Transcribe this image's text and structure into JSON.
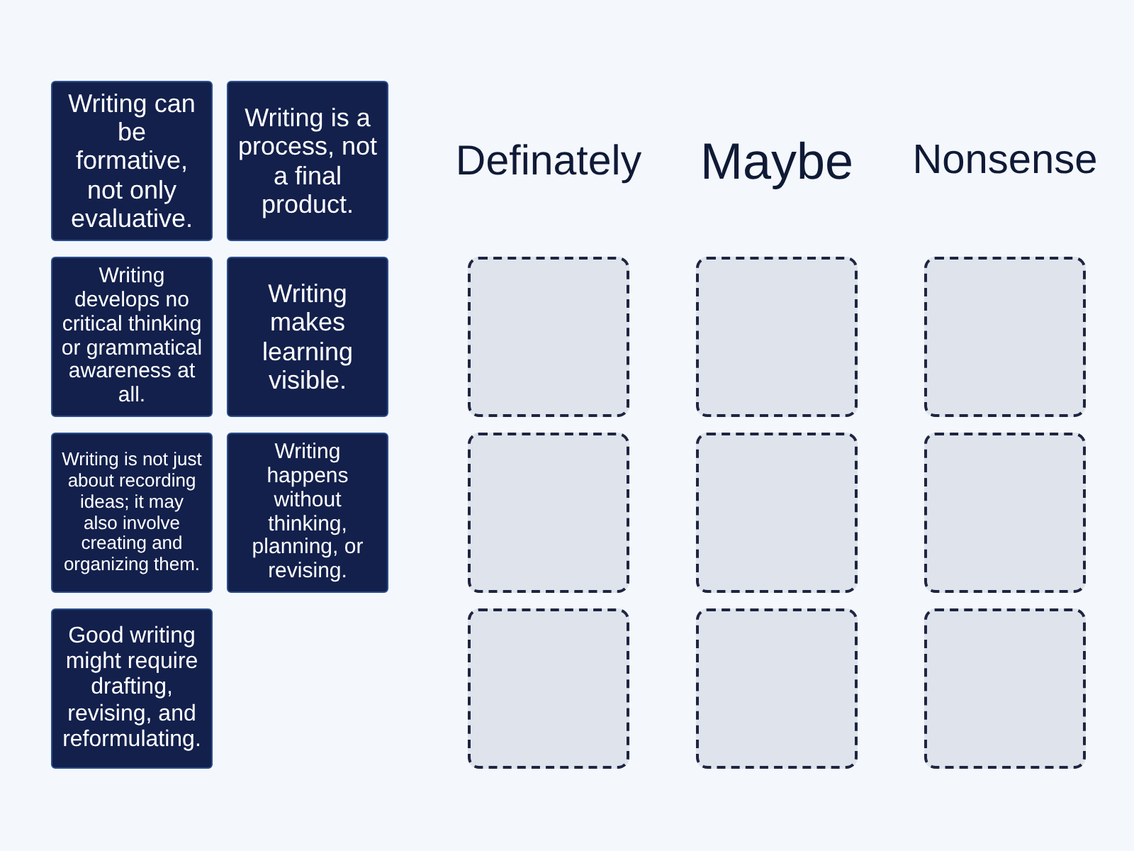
{
  "cards": [
    {
      "text": "Writing can be formative, not only evaluative."
    },
    {
      "text": "Writing is a process, not a final product."
    },
    {
      "text": "Writing develops no critical thinking or grammatical awareness at all."
    },
    {
      "text": "Writing makes learning visible."
    },
    {
      "text": "Writing is not just about recording ideas; it may also involve creating and organizing them."
    },
    {
      "text": "Writing happens without thinking, planning, or revising."
    },
    {
      "text": "Good writing might require drafting, revising, and reformulating."
    }
  ],
  "groups": [
    {
      "heading": "Definately",
      "slots": [
        {
          "empty": true
        },
        {
          "empty": true
        },
        {
          "empty": true
        }
      ]
    },
    {
      "heading": "Maybe",
      "slots": [
        {
          "empty": true
        },
        {
          "empty": true
        },
        {
          "empty": true
        }
      ]
    },
    {
      "heading": "Nonsense",
      "slots": [
        {
          "empty": true
        },
        {
          "empty": true
        },
        {
          "empty": true
        }
      ]
    }
  ]
}
